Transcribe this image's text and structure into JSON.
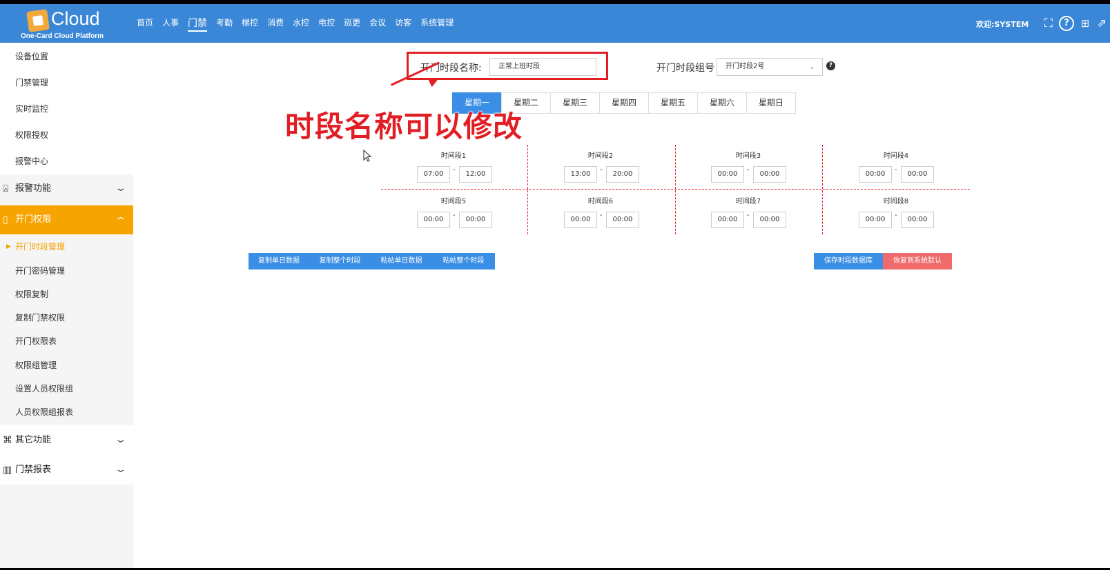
{
  "header": {
    "logo_text": "Cloud",
    "logo_sub": "One-Card Cloud Platform",
    "nav": [
      "首页",
      "人事",
      "门禁",
      "考勤",
      "梯控",
      "消费",
      "水控",
      "电控",
      "巡更",
      "会议",
      "访客",
      "系统管理"
    ],
    "active_nav": "门禁",
    "welcome": "欢迎:SYSTEM",
    "icons": [
      "fullscreen-icon",
      "help-icon",
      "translate-icon",
      "external-link-icon"
    ]
  },
  "sidebar": {
    "top_items": [
      "设备位置",
      "门禁管理",
      "实时监控",
      "权限授权",
      "报警中心"
    ],
    "group_alarm": "报警功能",
    "group_open": "开门权限",
    "open_items": [
      "开门时段管理",
      "开门密码管理",
      "权限复制",
      "复制门禁权限",
      "开门权限表",
      "权限组管理",
      "设置人员权限组",
      "人员权限组报表"
    ],
    "group_other": "其它功能",
    "group_report": "门禁报表"
  },
  "form": {
    "name_label": "开门时段名称:",
    "name_value": "正常上班时段",
    "group_label": "开门时段组号",
    "group_value": "开门时段2号"
  },
  "annotation": "时段名称可以修改",
  "weekdays": [
    "星期一",
    "星期二",
    "星期三",
    "星期四",
    "星期五",
    "星期六",
    "星期日"
  ],
  "active_weekday": "星期一",
  "segments": [
    {
      "title": "时间段1",
      "start": "07:00",
      "end": "12:00"
    },
    {
      "title": "时间段2",
      "start": "13:00",
      "end": "20:00"
    },
    {
      "title": "时间段3",
      "start": "00:00",
      "end": "00:00"
    },
    {
      "title": "时间段4",
      "start": "00:00",
      "end": "00:00"
    },
    {
      "title": "时间段5",
      "start": "00:00",
      "end": "00:00"
    },
    {
      "title": "时间段6",
      "start": "00:00",
      "end": "00:00"
    },
    {
      "title": "时间段7",
      "start": "00:00",
      "end": "00:00"
    },
    {
      "title": "时间段8",
      "start": "00:00",
      "end": "00:00"
    }
  ],
  "separator": "-",
  "actions": {
    "copy_day": "复制单日数据",
    "copy_all": "复制整个时段",
    "paste_day": "粘帖单日数据",
    "paste_all": "粘帖整个时段",
    "save": "保存时段数据库",
    "restore": "恢复到系统默认"
  },
  "colors": {
    "header_blue": "#3a87d7",
    "accent_orange": "#f6a400",
    "annotation_red": "#e21e25",
    "button_blue": "#3a8ee6",
    "button_red": "#ef6a6a"
  }
}
